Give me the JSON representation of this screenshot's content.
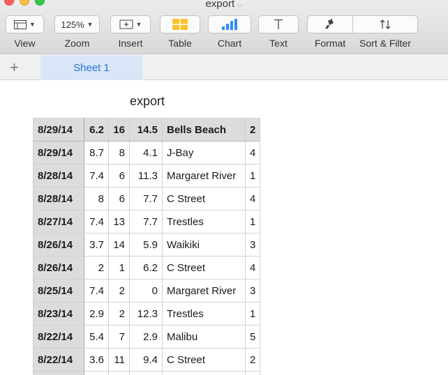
{
  "window": {
    "title": "export",
    "title_chevron": "⌵"
  },
  "toolbar": {
    "view": {
      "label": "View"
    },
    "zoom": {
      "label": "Zoom",
      "value": "125%"
    },
    "insert": {
      "label": "Insert"
    },
    "table": {
      "label": "Table"
    },
    "chart": {
      "label": "Chart"
    },
    "text": {
      "label": "Text"
    },
    "format": {
      "label": "Format"
    },
    "sort_filter": {
      "label": "Sort & Filter"
    },
    "table_icon_color": "#f8c32c",
    "chart_icon_color": "#2f8ef3"
  },
  "sheets": {
    "add_label": "+",
    "tabs": [
      {
        "label": "Sheet 1",
        "active": true
      }
    ],
    "accent": "#2a73d6"
  },
  "table": {
    "title": "export",
    "header": [
      "8/29/14",
      "6.2",
      "16",
      "14.5",
      "Bells Beach",
      "2"
    ],
    "rows": [
      [
        "8/29/14",
        "8.7",
        "8",
        "4.1",
        "J-Bay",
        "4"
      ],
      [
        "8/28/14",
        "7.4",
        "6",
        "11.3",
        "Margaret River",
        "1"
      ],
      [
        "8/28/14",
        "8",
        "6",
        "7.7",
        "C Street",
        "4"
      ],
      [
        "8/27/14",
        "7.4",
        "13",
        "7.7",
        "Trestles",
        "1"
      ],
      [
        "8/26/14",
        "3.7",
        "14",
        "5.9",
        "Waikiki",
        "3"
      ],
      [
        "8/26/14",
        "2",
        "1",
        "6.2",
        "C Street",
        "4"
      ],
      [
        "8/25/14",
        "7.4",
        "2",
        "0",
        "Margaret River",
        "3"
      ],
      [
        "8/23/14",
        "2.9",
        "2",
        "12.3",
        "Trestles",
        "1"
      ],
      [
        "8/22/14",
        "5.4",
        "7",
        "2.9",
        "Malibu",
        "5"
      ],
      [
        "8/22/14",
        "3.6",
        "11",
        "9.4",
        "C Street",
        "2"
      ]
    ]
  }
}
